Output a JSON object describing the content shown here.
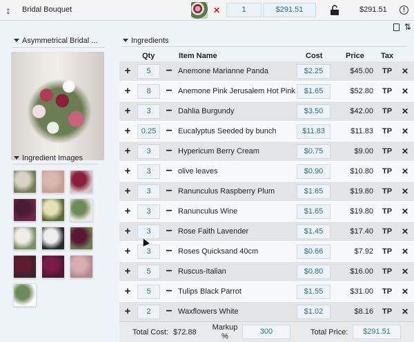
{
  "topbar": {
    "title": "Bridal Bouquet",
    "quantity": "1",
    "price": "$291.51",
    "total": "$291.51"
  },
  "left": {
    "arrangement_heading": "Asymmetrical Bridal ...",
    "images_heading": "Ingredient Images",
    "thumbnails": [
      {
        "name": "thumb-1",
        "colors": [
          "#d8d3c7",
          "#6f7b55"
        ]
      },
      {
        "name": "thumb-2",
        "colors": [
          "#d9b7ad",
          "#c89d92"
        ]
      },
      {
        "name": "thumb-3",
        "colors": [
          "#8a1f3b",
          "#d7c4c9"
        ]
      },
      {
        "name": "thumb-4",
        "colors": [
          "#4a1b34",
          "#6d2846"
        ]
      },
      {
        "name": "thumb-5",
        "colors": [
          "#e4e0b8",
          "#5b6b34"
        ]
      },
      {
        "name": "thumb-6",
        "colors": [
          "#6c8b5a",
          "#e9ece6"
        ]
      },
      {
        "name": "thumb-7",
        "colors": [
          "#f0ece6",
          "#7a8d63"
        ]
      },
      {
        "name": "thumb-8",
        "colors": [
          "#efefef",
          "#2a2a2a"
        ]
      },
      {
        "name": "thumb-9",
        "colors": [
          "#5a1733",
          "#6f7b55"
        ]
      },
      {
        "name": "thumb-10",
        "colors": [
          "#5f1b30",
          "#3f2228"
        ]
      },
      {
        "name": "thumb-11",
        "colors": [
          "#7a1a45",
          "#4f1532"
        ]
      },
      {
        "name": "thumb-12",
        "colors": [
          "#d7aeb1",
          "#b38a8c"
        ]
      },
      {
        "name": "thumb-13",
        "colors": [
          "#6c8b5a",
          "#ffffff"
        ]
      }
    ]
  },
  "ingredients": {
    "heading": "Ingredients",
    "columns": {
      "qty": "Qty",
      "item": "Item Name",
      "cost": "Cost",
      "price": "Price",
      "tax": "Tax"
    },
    "rows": [
      {
        "qty": "5",
        "name": "Anemone Marianne Panda",
        "cost": "$2.25",
        "price": "$45.00",
        "tax": "TP"
      },
      {
        "qty": "8",
        "name": "Anemone Pink Jerusalem Hot Pink",
        "cost": "$1.65",
        "price": "$52.80",
        "tax": "TP"
      },
      {
        "qty": "3",
        "name": "Dahlia Burgundy",
        "cost": "$3.50",
        "price": "$42.00",
        "tax": "TP"
      },
      {
        "qty": "0.25",
        "name": "Eucalyptus Seeded by bunch",
        "cost": "$11.83",
        "price": "$11.83",
        "tax": "TP"
      },
      {
        "qty": "3",
        "name": "Hypericum Berry Cream",
        "cost": "$0.75",
        "price": "$9.00",
        "tax": "TP"
      },
      {
        "qty": "3",
        "name": "olive leaves",
        "cost": "$0.90",
        "price": "$10.80",
        "tax": "TP"
      },
      {
        "qty": "3",
        "name": "Ranunculus Raspberry Plum",
        "cost": "$1.65",
        "price": "$19.80",
        "tax": "TP"
      },
      {
        "qty": "3",
        "name": "Ranunculus Wine",
        "cost": "$1.65",
        "price": "$19.80",
        "tax": "TP"
      },
      {
        "qty": "3",
        "name": "Rose Faith Lavender",
        "cost": "$1.45",
        "price": "$17.40",
        "tax": "TP"
      },
      {
        "qty": "3",
        "name": "Roses Quicksand 40cm",
        "cost": "$0.66",
        "price": "$7.92",
        "tax": "TP"
      },
      {
        "qty": "5",
        "name": "Ruscus-Italian",
        "cost": "$0.80",
        "price": "$16.00",
        "tax": "TP"
      },
      {
        "qty": "5",
        "name": "Tulips Black Parrot",
        "cost": "$1.55",
        "price": "$31.00",
        "tax": "TP"
      },
      {
        "qty": "2",
        "name": "Waxflowers White",
        "cost": "$1.02",
        "price": "$8.16",
        "tax": "TP"
      }
    ]
  },
  "footer": {
    "total_cost_label": "Total Cost:",
    "total_cost": "$72.88",
    "markup_label_1": "Markup",
    "markup_label_2": "%",
    "markup": "300",
    "total_price_label": "Total Price:",
    "total_price": "$291.51"
  },
  "colors": {
    "accent": "#2a6f8c",
    "delete": "#c0202a"
  }
}
